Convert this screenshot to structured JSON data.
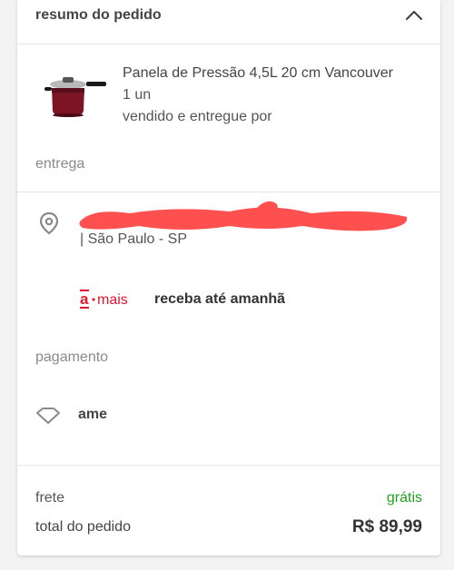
{
  "header": {
    "title": "resumo do pedido"
  },
  "product": {
    "name": "Panela de Pressão 4,5L 20 cm Vancouver",
    "quantity": "1 un",
    "seller": "vendido e entregue por"
  },
  "delivery": {
    "section_label": "entrega",
    "city": "| São Paulo - SP",
    "service_text": "receba até amanhã"
  },
  "payment": {
    "section_label": "pagamento",
    "method": "ame"
  },
  "summary": {
    "shipping_label": "frete",
    "shipping_value": "grátis",
    "total_label": "total do pedido",
    "total_value": "R$ 89,99"
  },
  "colors": {
    "brand_red": "#e0182d",
    "free_green": "#1fa01f",
    "redaction": "#ff5050"
  },
  "icons": [
    "chevron-up-icon",
    "location-pin-icon",
    "ame-diamond-icon"
  ]
}
